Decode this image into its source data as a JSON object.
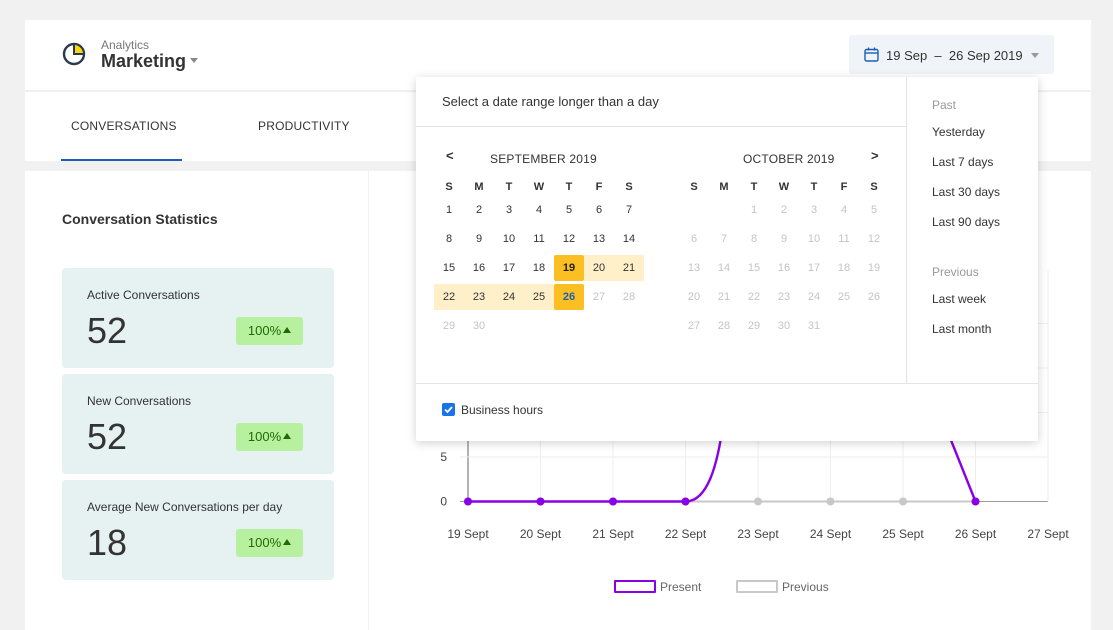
{
  "header": {
    "app_small": "Analytics",
    "app_name": "Marketing",
    "date_range": "19 Sep  –  26 Sep 2019"
  },
  "tabs": [
    {
      "label": "CONVERSATIONS",
      "active": true
    },
    {
      "label": "PRODUCTIVITY",
      "active": false
    }
  ],
  "stats": {
    "title": "Conversation Statistics",
    "cards": [
      {
        "label": "Active Conversations",
        "value": "52",
        "change": "100%"
      },
      {
        "label": "New Conversations",
        "value": "52",
        "change": "100%"
      },
      {
        "label": "Average New Conversations per day",
        "value": "18",
        "change": "100%"
      }
    ]
  },
  "chart_data": {
    "type": "line",
    "categories": [
      "19 Sept",
      "20 Sept",
      "21 Sept",
      "22 Sept",
      "23 Sept",
      "24 Sept",
      "25 Sept",
      "26 Sept",
      "27 Sept"
    ],
    "y_ticks_visible": [
      0,
      5
    ],
    "series": [
      {
        "name": "Present",
        "color": "#8a00e6",
        "values": [
          0,
          0,
          0,
          0,
          null,
          null,
          null,
          0
        ]
      },
      {
        "name": "Previous",
        "color": "#c8c8c8",
        "values": [
          0,
          0,
          0,
          0,
          0,
          0,
          0,
          0
        ]
      }
    ],
    "legend": [
      "Present",
      "Previous"
    ],
    "legend_position": "bottom"
  },
  "datepicker": {
    "prompt": "Select a date range longer than a day",
    "prev_arrow": "<",
    "next_arrow": ">",
    "months": [
      {
        "title": "SEPTEMBER 2019"
      },
      {
        "title": "OCTOBER 2019"
      }
    ],
    "weekdays": [
      "S",
      "M",
      "T",
      "W",
      "T",
      "F",
      "S"
    ],
    "range_start": 19,
    "range_end": 26,
    "presets": {
      "past_heading": "Past",
      "past": [
        "Yesterday",
        "Last 7 days",
        "Last 30 days",
        "Last 90 days"
      ],
      "previous_heading": "Previous",
      "previous": [
        "Last week",
        "Last month"
      ]
    },
    "business_hours_label": "Business hours",
    "business_hours_checked": true
  }
}
